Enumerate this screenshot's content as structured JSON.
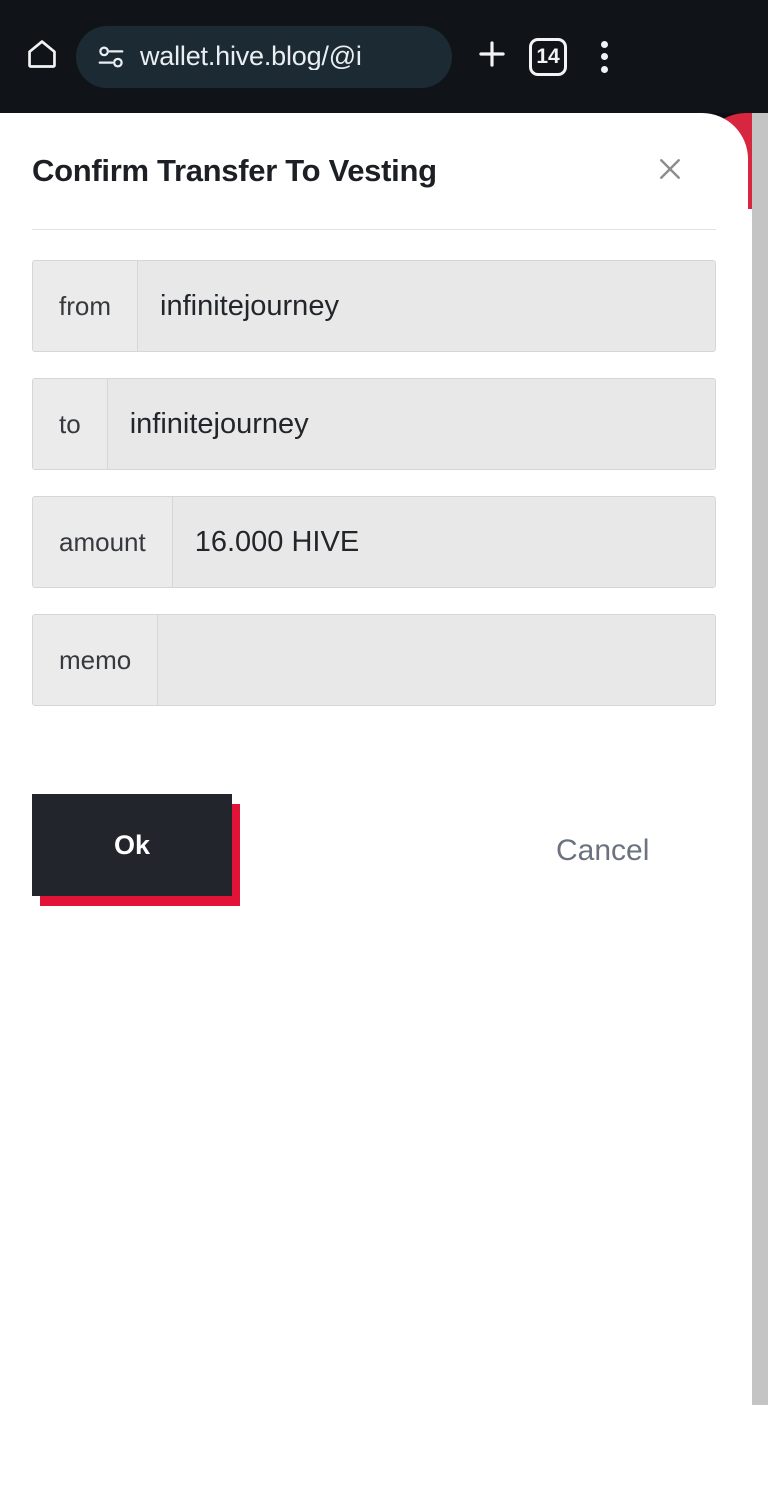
{
  "browser": {
    "home_icon": "home-icon",
    "permissions_icon": "tune-permissions-icon",
    "url": "wallet.hive.blog/@i",
    "new_tab_label": "+",
    "tab_count": "14",
    "menu_icon": "more-vertical-icon"
  },
  "dialog": {
    "title": "Confirm Transfer To Vesting",
    "close_label": "×",
    "fields": [
      {
        "label": "from",
        "value": "infinitejourney"
      },
      {
        "label": "to",
        "value": "infinitejourney"
      },
      {
        "label": "amount",
        "value": "16.000 HIVE"
      },
      {
        "label": "memo",
        "value": ""
      }
    ],
    "ok_label": "Ok",
    "cancel_label": "Cancel"
  },
  "colors": {
    "chrome_bg": "#101418",
    "omnibox_bg": "#1c2a33",
    "accent_red": "#e31337",
    "ok_dark": "#22262c",
    "field_bg": "#e8e8e8",
    "field_border": "#d6d6d6",
    "cancel_text": "#6b7280",
    "scrollbar": "#c4c4c4"
  }
}
